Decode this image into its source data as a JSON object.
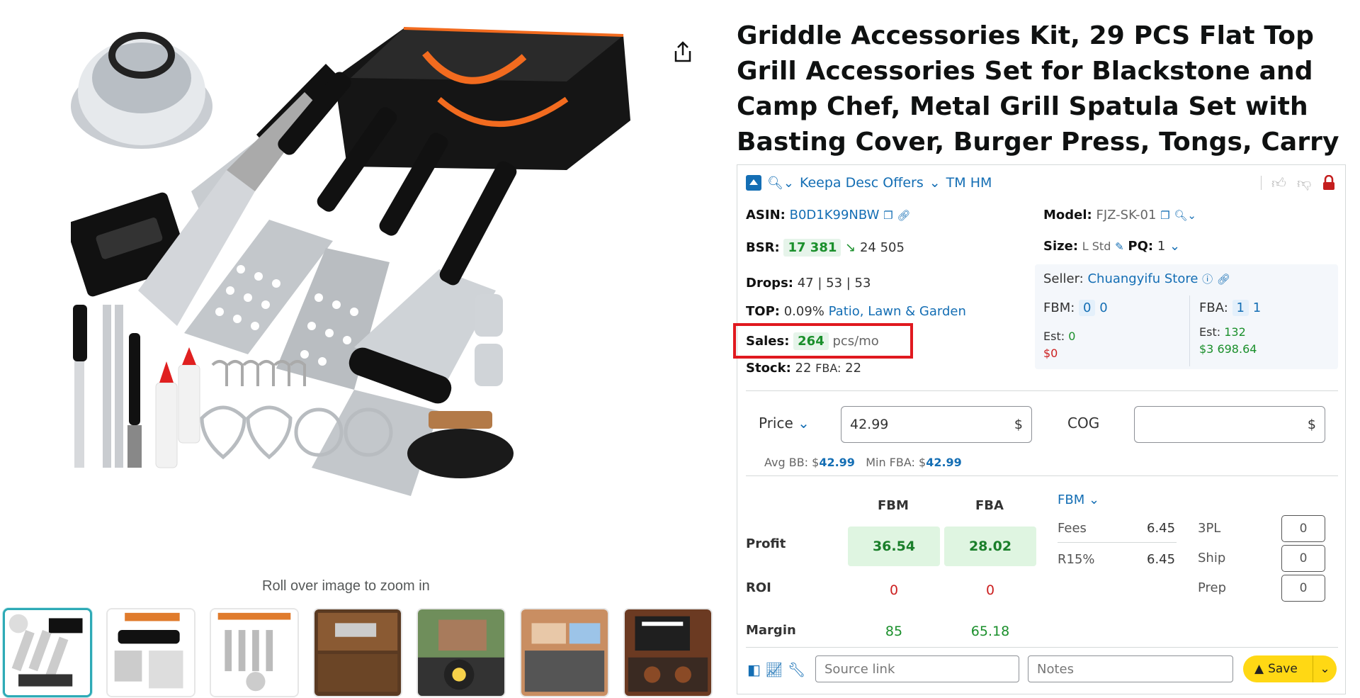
{
  "product": {
    "title": "Griddle Accessories Kit, 29 PCS Flat Top Grill Accessories Set for Blackstone and Camp Chef, Metal Grill Spatula Set with Basting Cover, Burger Press, Tongs, Carry Bag for Outdoor Grilling BBQ"
  },
  "gallery": {
    "zoom_hint": "Roll over image to zoom in",
    "thumb_count": 7
  },
  "keepa": {
    "header": {
      "offers_link": "Keepa Desc Offers",
      "tm_link": "TM HM"
    },
    "asin_label": "ASIN:",
    "asin": "B0D1K99NBW",
    "bsr_label": "BSR:",
    "bsr": "17 381",
    "bsr_prev": "24 505",
    "drops_label": "Drops:",
    "drops": "47 | 53 | 53",
    "top_label": "TOP:",
    "top_pct": "0.09%",
    "top_category": "Patio, Lawn & Garden",
    "sales_label": "Sales:",
    "sales": "264",
    "sales_unit": "pcs/mo",
    "stock_label": "Stock:",
    "stock": "22",
    "stock_fba_label": "FBA:",
    "stock_fba": "22",
    "model_label": "Model:",
    "model": "FJZ-SK-01",
    "size_label": "Size:",
    "size": "L Std",
    "pq_label": "PQ:",
    "pq": "1",
    "seller_label": "Seller:",
    "seller": "Chuangyifu Store",
    "fbm_label": "FBM:",
    "fbm_a": "0",
    "fbm_b": "0",
    "fba_label": "FBA:",
    "fba_a": "1",
    "fba_b": "1",
    "est_label": "Est:",
    "fbm_est": "0",
    "fbm_est_money": "$0",
    "fba_est": "132",
    "fba_est_money": "$3 698.64",
    "price_label": "Price",
    "price_value": "42.99",
    "currency": "$",
    "cog_label": "COG",
    "avg_bb_label": "Avg BB: $",
    "avg_bb": "42.99",
    "min_fba_label": "Min FBA: $",
    "min_fba": "42.99",
    "col_fbm": "FBM",
    "col_fba": "FBA",
    "fee_mode": "FBM",
    "row_profit": "Profit",
    "row_roi": "ROI",
    "row_margin": "Margin",
    "profit_fbm": "36.54",
    "profit_fba": "28.02",
    "roi_fbm": "0",
    "roi_fba": "0",
    "margin_fbm": "85",
    "margin_fba": "65.18",
    "fees_label": "Fees",
    "fees_value": "6.45",
    "r15_label": "R15%",
    "r15_value": "6.45",
    "tpl_label": "3PL",
    "tpl_value": "0",
    "ship_label": "Ship",
    "ship_value": "0",
    "prep_label": "Prep",
    "prep_value": "0",
    "source_placeholder": "Source link",
    "notes_placeholder": "Notes",
    "save_label": "Save"
  },
  "colors": {
    "accent": "#146eb4",
    "highlight": "#e0191f",
    "good": "#1a8f2b",
    "bad": "#cc2020",
    "save": "#ffd814",
    "thumb_active": "#2eaab6"
  }
}
